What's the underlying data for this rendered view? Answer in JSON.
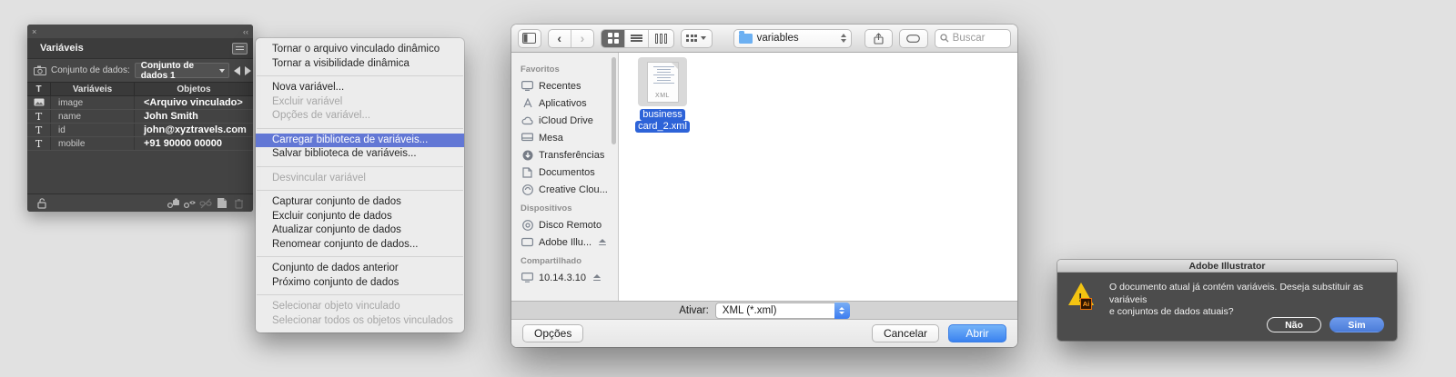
{
  "variables_panel": {
    "close_glyph": "×",
    "collapse_glyph": "‹‹",
    "tab_title": "Variáveis",
    "dataset_label": "Conjunto de dados:",
    "dataset_value": "Conjunto de dados 1",
    "columns": {
      "type": "T",
      "variables": "Variáveis",
      "objects": "Objetos"
    },
    "rows": [
      {
        "type_glyph": "",
        "name": "image",
        "value": "<Arquivo vinculado>"
      },
      {
        "type_glyph": "T",
        "name": "name",
        "value": "John Smith"
      },
      {
        "type_glyph": "T",
        "name": "id",
        "value": "john@xyztravels.com"
      },
      {
        "type_glyph": "T",
        "name": "mobile",
        "value": "+91 90000 00000"
      }
    ]
  },
  "context_menu": {
    "items": [
      {
        "label": "Tornar o arquivo vinculado dinâmico",
        "state": "normal"
      },
      {
        "label": "Tornar a visibilidade dinâmica",
        "state": "normal"
      },
      {
        "label": "Nova variável...",
        "state": "normal"
      },
      {
        "label": "Excluir variável",
        "state": "disabled"
      },
      {
        "label": "Opções de variável...",
        "state": "disabled"
      },
      {
        "label": "Carregar biblioteca de variáveis...",
        "state": "selected"
      },
      {
        "label": "Salvar biblioteca de variáveis...",
        "state": "normal"
      },
      {
        "label": "Desvincular variável",
        "state": "disabled"
      },
      {
        "label": "Capturar conjunto de dados",
        "state": "normal"
      },
      {
        "label": "Excluir conjunto de dados",
        "state": "normal"
      },
      {
        "label": "Atualizar conjunto de dados",
        "state": "normal"
      },
      {
        "label": "Renomear conjunto de dados...",
        "state": "normal"
      },
      {
        "label": "Conjunto de dados anterior",
        "state": "normal"
      },
      {
        "label": "Próximo conjunto de dados",
        "state": "normal"
      },
      {
        "label": "Selecionar objeto vinculado",
        "state": "disabled"
      },
      {
        "label": "Selecionar todos os objetos vinculados",
        "state": "disabled"
      }
    ]
  },
  "file_dialog": {
    "toolbar": {
      "folder_name": "variables",
      "search_placeholder": "Buscar"
    },
    "sidebar": {
      "sections": [
        {
          "title": "Favoritos",
          "items": [
            "Recentes",
            "Aplicativos",
            "iCloud Drive",
            "Mesa",
            "Transferências",
            "Documentos",
            "Creative Clou..."
          ]
        },
        {
          "title": "Dispositivos",
          "items": [
            "Disco Remoto",
            "Adobe Illu..."
          ]
        },
        {
          "title": "Compartilhado",
          "items": [
            "10.14.3.10"
          ]
        }
      ]
    },
    "file": {
      "badge": "XML",
      "name_line1": "business",
      "name_line2": "card_2.xml"
    },
    "format": {
      "label": "Ativar:",
      "value": "XML (*.xml)"
    },
    "buttons": {
      "options": "Opções",
      "cancel": "Cancelar",
      "open": "Abrir"
    }
  },
  "alert": {
    "title": "Adobe Illustrator",
    "message_line1": "O documento atual já contém variáveis. Deseja substituir as variáveis",
    "message_line2": "e conjuntos de dados atuais?",
    "no_label": "Não",
    "yes_label": "Sim"
  },
  "colors": {
    "menu_selection": "#6277d5",
    "file_selection": "#2d63d8",
    "open_button": "#3a82f0",
    "alert_yes": "#5b8ade",
    "warning_yellow": "#f3c412"
  }
}
